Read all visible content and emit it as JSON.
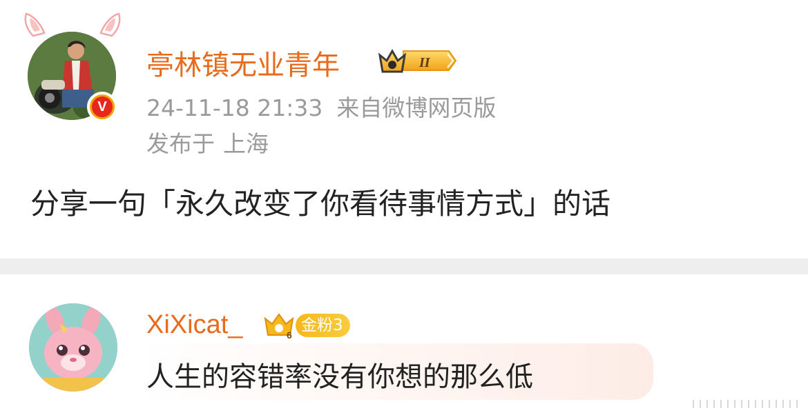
{
  "post": {
    "author": {
      "name": "亭林镇无业青年",
      "avatar_icon": "person-with-motorcycle-avatar",
      "verified_icon": "verified-v-badge-icon",
      "verified_mark": "V",
      "rank_badge_text": "II"
    },
    "timestamp": "24-11-18 21:33",
    "source": "来自微博网页版",
    "location_prefix": "发布于",
    "location": "上海",
    "text": "分享一句「永久改变了你看待事情方式」的话"
  },
  "comment": {
    "author": {
      "name": "XiXicat_",
      "avatar_icon": "pink-bunny-plush-avatar",
      "fan_level_number": "6",
      "fan_badge_label": "金粉3"
    },
    "text": "人生的容错率没有你想的那么低"
  },
  "colors": {
    "username": "#e86b1c",
    "meta": "#9a9a9a",
    "text": "#222222",
    "divider": "#eeeeee",
    "badge_gold": "#f6b81a",
    "verified_red": "#e8261e"
  }
}
